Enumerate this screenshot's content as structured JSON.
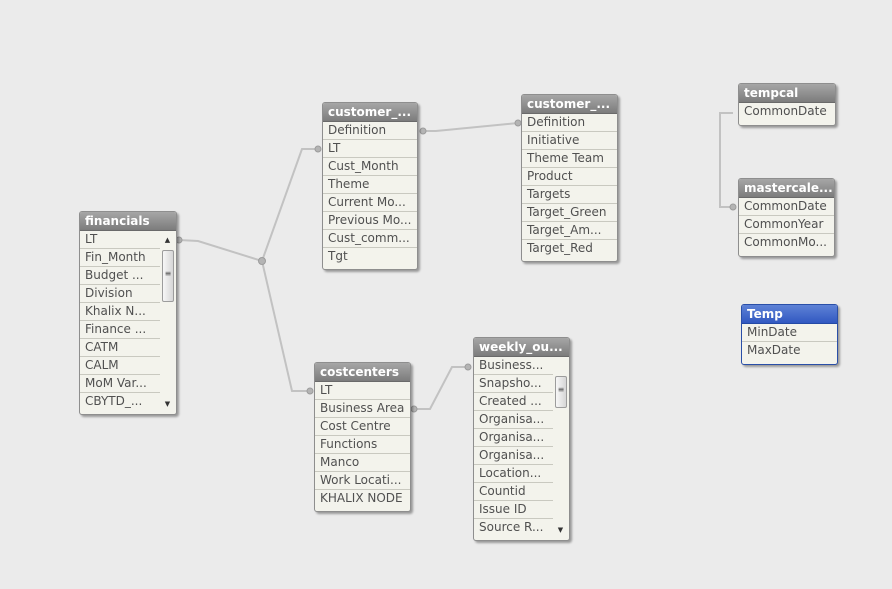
{
  "tables": [
    {
      "id": "financials",
      "title": "financials",
      "active": false,
      "fields": [
        "LT",
        "Fin_Month",
        "Budget ...",
        "Division",
        "Khalix N...",
        "Finance ...",
        "CATM",
        "CALM",
        "MoM Var...",
        "CBYTD_..."
      ]
    },
    {
      "id": "customer1",
      "title": "customer_...",
      "active": false,
      "fields": [
        "Definition",
        "LT",
        "Cust_Month",
        "Theme",
        "Current Mo...",
        "Previous Mo...",
        "Cust_comm...",
        "Tgt"
      ]
    },
    {
      "id": "customer2",
      "title": "customer_...",
      "active": false,
      "fields": [
        "Definition",
        "Initiative",
        "Theme Team",
        "Product",
        "Targets",
        "Target_Green",
        "Target_Am...",
        "Target_Red"
      ]
    },
    {
      "id": "costcenters",
      "title": "costcenters",
      "active": false,
      "fields": [
        "LT",
        "Business Area",
        "Cost Centre",
        "Functions",
        "Manco",
        "Work Locati...",
        "KHALIX NODE"
      ]
    },
    {
      "id": "weekly",
      "title": "weekly_ou...",
      "active": false,
      "fields": [
        "Business...",
        "Snapsho...",
        "Created ...",
        "Organisa...",
        "Organisa...",
        "Organisa...",
        "Location...",
        "Countid",
        "Issue ID",
        "Source R..."
      ]
    },
    {
      "id": "tempcal",
      "title": "tempcal",
      "active": false,
      "fields": [
        "CommonDate"
      ]
    },
    {
      "id": "mastercal",
      "title": "mastercale...",
      "active": false,
      "fields": [
        "CommonDate",
        "CommonYear",
        "CommonMo..."
      ]
    },
    {
      "id": "temp",
      "title": "Temp",
      "active": true,
      "fields": [
        "MinDate",
        "MaxDate"
      ]
    }
  ],
  "icons": {
    "scroll_up": "scroll-up-arrow-icon",
    "scroll_down": "scroll-down-arrow-icon",
    "scroll_grip": "scroll-grip-icon"
  },
  "colors": {
    "background": "#ebebeb",
    "title_bar": "#8a8a8a",
    "active_title_bar": "#3a62c8",
    "field_bg": "#f3f3ec",
    "link": "#c2c2c2"
  }
}
